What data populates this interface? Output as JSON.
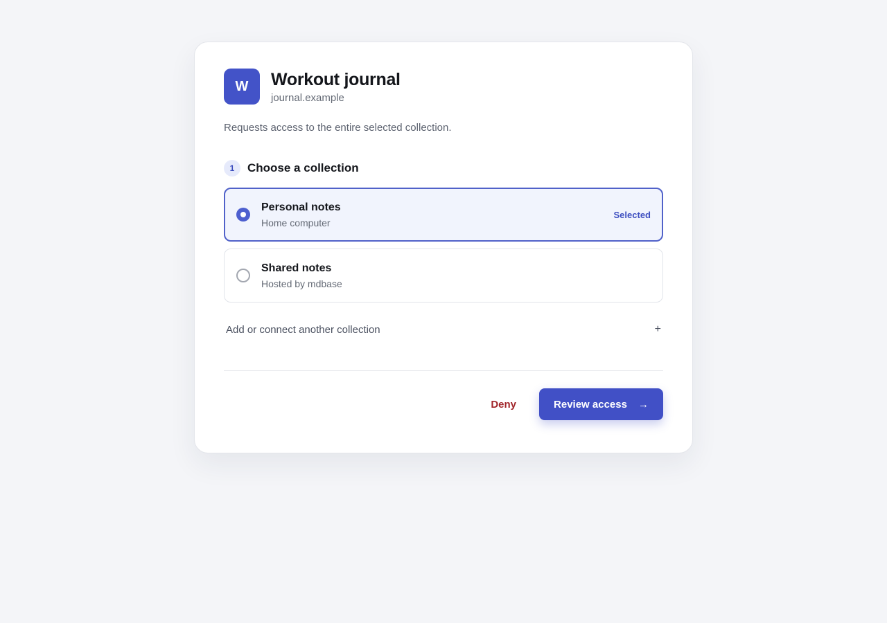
{
  "app": {
    "logo_letter": "W",
    "title": "Workout journal",
    "domain": "journal.example",
    "description": "Requests access to the entire selected collection."
  },
  "step": {
    "number": "1",
    "title": "Choose a collection"
  },
  "collections": [
    {
      "name": "Personal notes",
      "subtitle": "Home computer",
      "status": "Selected",
      "selected": true
    },
    {
      "name": "Shared notes",
      "subtitle": "Hosted by mdbase",
      "status": "",
      "selected": false
    }
  ],
  "add_collection": {
    "label": "Add or connect another collection",
    "icon": "+"
  },
  "actions": {
    "deny_label": "Deny",
    "review_label": "Review access",
    "review_icon": "→"
  },
  "colors": {
    "accent": "#4150c6",
    "deny": "#a1262b",
    "selected_bg": "#f1f4fd",
    "page_bg": "#f4f5f8"
  }
}
